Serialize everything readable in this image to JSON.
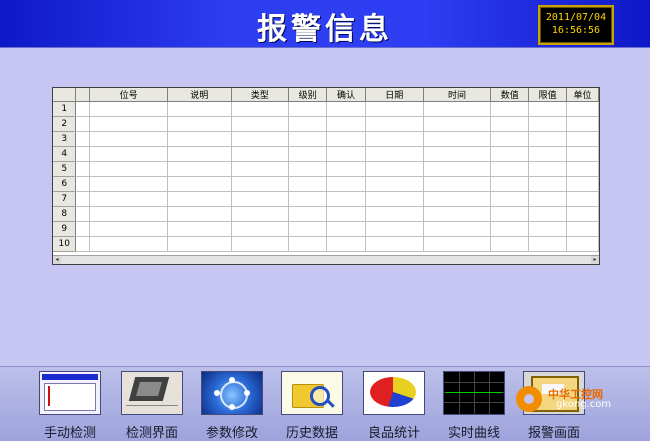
{
  "header": {
    "title": "报警信息",
    "clock_date": "2011/07/04",
    "clock_time": "16:56:56"
  },
  "alarm_table": {
    "columns": [
      "位号",
      "说明",
      "类型",
      "级别",
      "确认",
      "日期",
      "时间",
      "数值",
      "限值",
      "单位"
    ],
    "row_numbers": [
      "1",
      "2",
      "3",
      "4",
      "5",
      "6",
      "7",
      "8",
      "9",
      "10"
    ],
    "scroll_left_arrow": "◂",
    "scroll_right_arrow": "▸"
  },
  "toolbar": {
    "items": [
      {
        "label": "手动检测",
        "icon": "manual-test-icon"
      },
      {
        "label": "检测界面",
        "icon": "test-screen-icon"
      },
      {
        "label": "参数修改",
        "icon": "parameter-edit-icon"
      },
      {
        "label": "历史数据",
        "icon": "history-data-icon"
      },
      {
        "label": "良品统计",
        "icon": "yield-statistics-icon"
      },
      {
        "label": "实时曲线",
        "icon": "realtime-curve-icon"
      },
      {
        "label": "报警画面",
        "icon": "alarm-screen-icon"
      }
    ]
  },
  "watermark": {
    "line1": "中华工控网",
    "line2": "gkong.com"
  },
  "colors": {
    "header_blue": "#2d3df0",
    "background": "#c7c6f2",
    "clock_text": "#ffd400"
  }
}
